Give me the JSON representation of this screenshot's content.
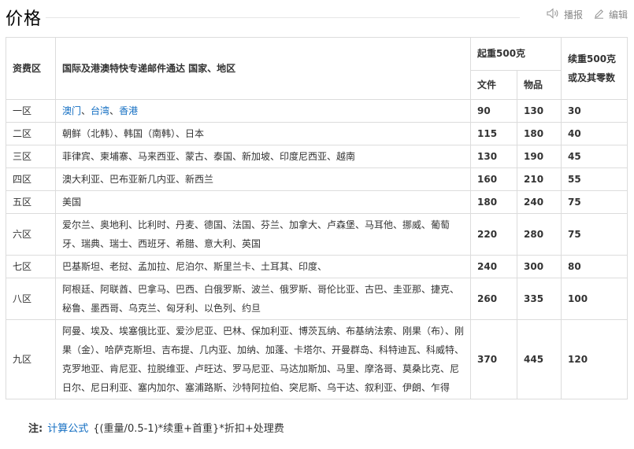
{
  "header": {
    "title": "价格",
    "play_label": "播报",
    "edit_label": "编辑"
  },
  "table": {
    "zone_header": "资费区",
    "region_header": "国际及港澳特快专递邮件通达 国家、地区",
    "first_weight_header": "起重500克",
    "doc_header": "文件",
    "item_header": "物品",
    "additional_header": "续重500克或及其零数",
    "rows": [
      {
        "zone": "一区",
        "region": "",
        "links": [
          "澳门",
          "台湾",
          "香港"
        ],
        "sep": "、",
        "doc": "90",
        "item": "130",
        "extra": "30"
      },
      {
        "zone": "二区",
        "region": "朝鲜（北韩）、韩国（南韩）、日本",
        "doc": "115",
        "item": "180",
        "extra": "40"
      },
      {
        "zone": "三区",
        "region": "菲律宾、柬埔寨、马来西亚、蒙古、泰国、新加坡、印度尼西亚、越南",
        "doc": "130",
        "item": "190",
        "extra": "45"
      },
      {
        "zone": "四区",
        "region": "澳大利亚、巴布亚新几内亚、新西兰",
        "doc": "160",
        "item": "210",
        "extra": "55"
      },
      {
        "zone": "五区",
        "region": "美国",
        "doc": "180",
        "item": "240",
        "extra": "75"
      },
      {
        "zone": "六区",
        "region": "爱尔兰、奥地利、比利时、丹麦、德国、法国、芬兰、加拿大、卢森堡、马耳他、挪威、葡萄牙、瑞典、瑞士、西班牙、希腊、意大利、英国",
        "doc": "220",
        "item": "280",
        "extra": "75"
      },
      {
        "zone": "七区",
        "region": "巴基斯坦、老挝、孟加拉、尼泊尔、斯里兰卡、土耳其、印度、",
        "doc": "240",
        "item": "300",
        "extra": "80"
      },
      {
        "zone": "八区",
        "region": "阿根廷、阿联酋、巴拿马、巴西、白俄罗斯、波兰、俄罗斯、哥伦比亚、古巴、圭亚那、捷克、秘鲁、墨西哥、乌克兰、匈牙利、以色列、约旦",
        "doc": "260",
        "item": "335",
        "extra": "100"
      },
      {
        "zone": "九区",
        "region": "阿曼、埃及、埃塞俄比亚、爱沙尼亚、巴林、保加利亚、博茨瓦纳、布基纳法索、刚果（布）、刚果（金）、哈萨克斯坦、吉布提、几内亚、加纳、加蓬、卡塔尔、开曼群岛、科特迪瓦、科威特、克罗地亚、肯尼亚、拉脱维亚、卢旺达、罗马尼亚、马达加斯加、马里、摩洛哥、莫桑比克、尼日尔、尼日利亚、塞内加尔、塞浦路斯、沙特阿拉伯、突尼斯、乌干达、叙利亚、伊朗、乍得",
        "doc": "370",
        "item": "445",
        "extra": "120"
      }
    ]
  },
  "note": {
    "label": "注:",
    "link": "计算公式",
    "formula": "{(重量/0.5-1)*续重+首重}*折扣+处理费"
  }
}
